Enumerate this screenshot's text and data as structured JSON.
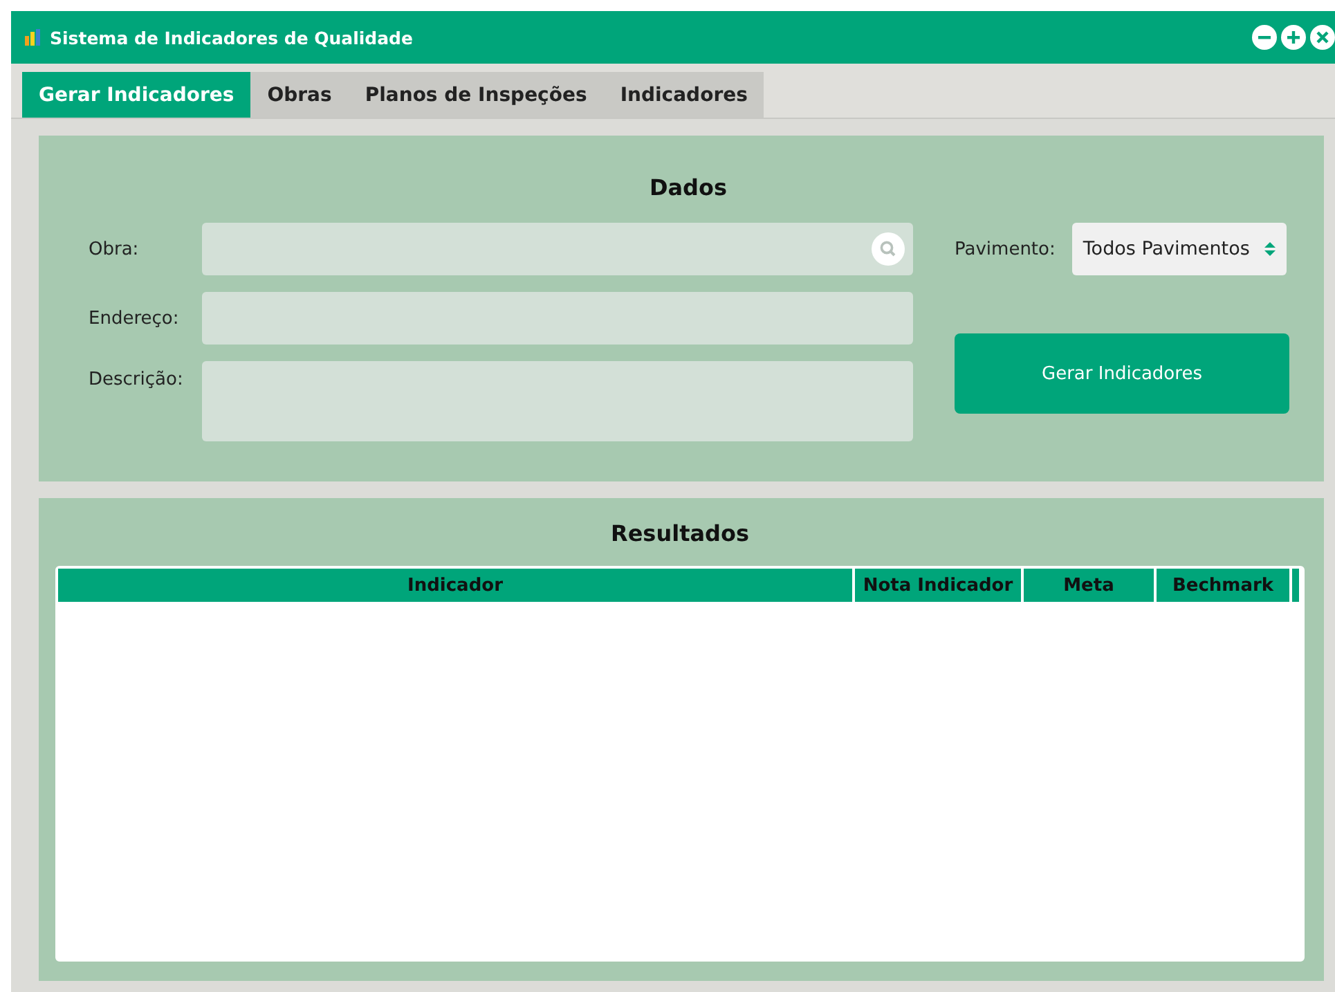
{
  "window": {
    "title": "Sistema de Indicadores de Qualidade"
  },
  "tabs": [
    {
      "label": "Gerar Indicadores",
      "selected": true
    },
    {
      "label": "Obras",
      "selected": false
    },
    {
      "label": "Planos de Inspeções",
      "selected": false
    },
    {
      "label": "Indicadores",
      "selected": false
    }
  ],
  "dados": {
    "title": "Dados",
    "fields": [
      {
        "label": "Obra:",
        "kind": "search"
      },
      {
        "label": "Endereço:",
        "kind": "text"
      },
      {
        "label": "Descrição:",
        "kind": "area"
      }
    ],
    "pavimento": {
      "label": "Pavimento:",
      "value": "Todos Pavimentos"
    },
    "button": "Gerar Indicadores"
  },
  "resultados": {
    "title": "Resultados",
    "columns": [
      "Indicador",
      "Nota Indicador",
      "Meta",
      "Bechmark"
    ]
  }
}
